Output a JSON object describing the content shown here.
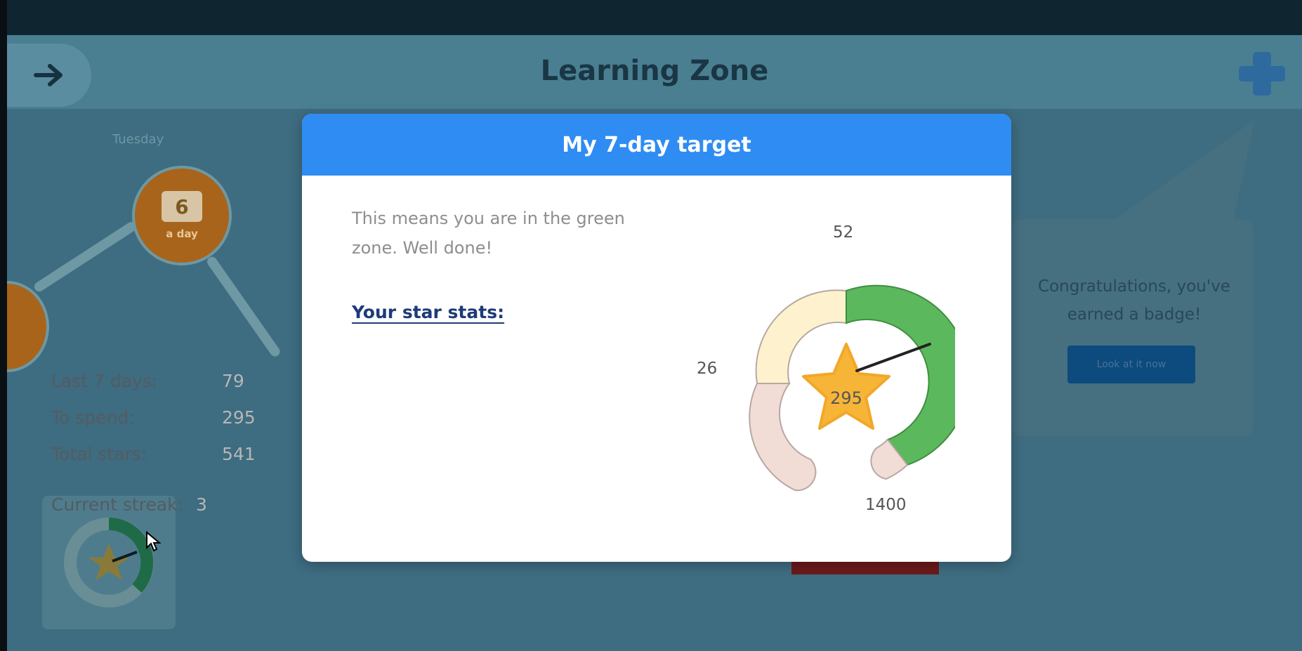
{
  "app": {
    "title": "Learning Zone",
    "back_icon": "arrow-right-icon",
    "logo_icon": "puzzle-logo-icon",
    "path_caption": "Tuesday",
    "node_day_number": "6",
    "node_day_sub": "a day",
    "badge_message": "Congratulations, you've earned a badge!",
    "badge_button": "Look at it now"
  },
  "modal": {
    "title": "My 7-day target",
    "message": "This means you are in the green zone. Well done!",
    "stats_heading": "Your star stats:",
    "stats": [
      {
        "label": "Last 7 days:",
        "value": "79"
      },
      {
        "label": "To spend:",
        "value": "295"
      },
      {
        "label": "Total stars:",
        "value": "541"
      }
    ],
    "streak": {
      "label": "Current streak:",
      "value": "3"
    }
  },
  "gauge": {
    "center_value": "295",
    "label_top": "52",
    "label_left": "26",
    "label_bottom_right": "1400",
    "zone_colors": {
      "red": "#f1dcd6",
      "yellow": "#fdf2cd",
      "green": "#5cb85c"
    },
    "star_color": "#f7b538",
    "needle_color": "#222222"
  }
}
